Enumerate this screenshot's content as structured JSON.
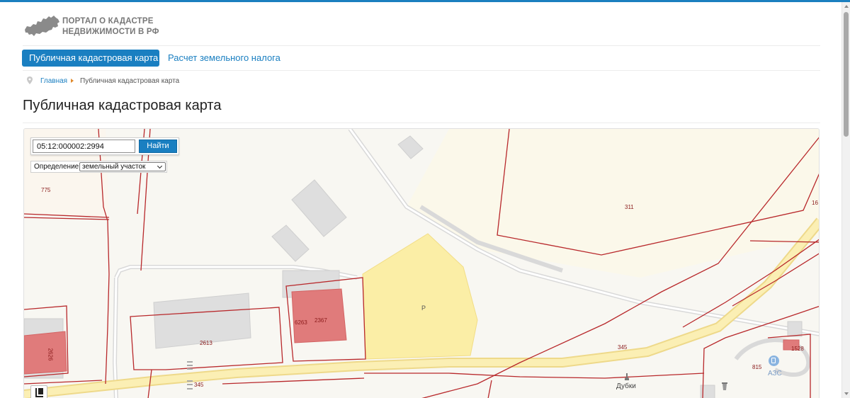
{
  "header": {
    "logo_line1": "ПОРТАЛ О КАДАСТРЕ",
    "logo_line2": "НЕДВИЖИМОСТИ В РФ"
  },
  "nav": {
    "tabs": [
      {
        "label": "Публичная кадастровая карта",
        "active": true
      },
      {
        "label": "Расчет земельного налога",
        "active": false
      }
    ]
  },
  "breadcrumb": {
    "home": "Главная",
    "current": "Публичная кадастровая карта"
  },
  "page": {
    "title": "Публичная кадастровая карта"
  },
  "search": {
    "value": "05:12:000002:2994",
    "button_label": "Найти"
  },
  "definition": {
    "label": "Определение:",
    "selected": "земельный участок"
  },
  "map_labels": {
    "parcel_775": "775",
    "parcel_311": "311",
    "parcel_16": "16",
    "parcel_6263": "6263",
    "parcel_2367": "2367",
    "parcel_2613": "2613",
    "parcel_2626": "2626",
    "parcel_345_a": "345",
    "parcel_345_b": "345",
    "parcel_815": "815",
    "parcel_1528": "1528",
    "zone_p": "Р",
    "place_dubki": "Дубки",
    "gas_station": "АЗС"
  },
  "colors": {
    "accent": "#1a7fc1",
    "parcel_border": "#c0282d",
    "highlight_fill": "#fbeea6",
    "building_red": "#e07b7b"
  }
}
